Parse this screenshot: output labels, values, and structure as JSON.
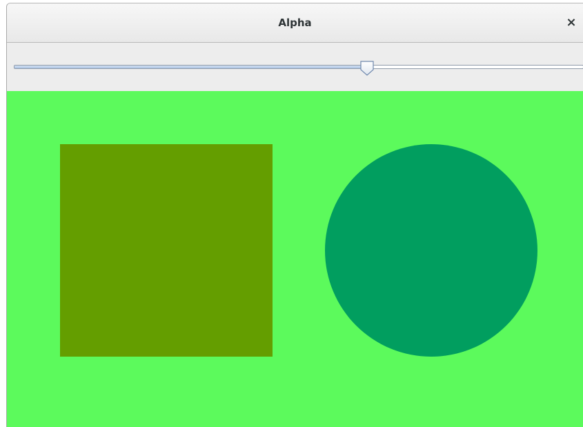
{
  "window": {
    "title": "Alpha",
    "close_glyph": "×",
    "close_icon": "close-icon"
  },
  "slider": {
    "value": 0.62,
    "thumb_icon": "slider-thumb"
  },
  "canvas": {
    "background_color": "#5cfa5c",
    "square_color": "#649e00",
    "circle_color": "#019e5f"
  }
}
